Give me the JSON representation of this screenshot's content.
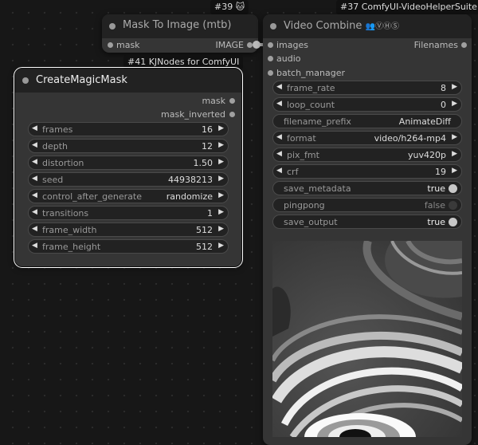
{
  "mask_to_image": {
    "badge": "#39",
    "badge_icon": "fox-icon",
    "title": "Mask To Image (mtb)",
    "input": "mask",
    "output": "IMAGE"
  },
  "magic_mask": {
    "badge": "#41 KJNodes for ComfyUI",
    "title": "CreateMagicMask",
    "outputs": [
      "mask",
      "mask_inverted"
    ],
    "widgets": [
      {
        "label": "frames",
        "value": "16"
      },
      {
        "label": "depth",
        "value": "12"
      },
      {
        "label": "distortion",
        "value": "1.50"
      },
      {
        "label": "seed",
        "value": "44938213"
      },
      {
        "label": "control_after_generate",
        "value": "randomize"
      },
      {
        "label": "transitions",
        "value": "1"
      },
      {
        "label": "frame_width",
        "value": "512"
      },
      {
        "label": "frame_height",
        "value": "512"
      }
    ]
  },
  "video_combine": {
    "badge": "#37 ComfyUI-VideoHelperSuite",
    "title": "Video Combine",
    "title_icons": "👥ⓋⒽⓈ",
    "inputs": [
      "images",
      "audio",
      "batch_manager"
    ],
    "output": "Filenames",
    "widgets": [
      {
        "label": "frame_rate",
        "value": "8"
      },
      {
        "label": "loop_count",
        "value": "0"
      },
      {
        "label": "filename_prefix",
        "value": "AnimateDiff"
      },
      {
        "label": "format",
        "value": "video/h264-mp4"
      },
      {
        "label": "pix_fmt",
        "value": "yuv420p"
      },
      {
        "label": "crf",
        "value": "19"
      },
      {
        "label": "save_metadata",
        "value": "true"
      },
      {
        "label": "pingpong",
        "value": "false"
      },
      {
        "label": "save_output",
        "value": "true"
      }
    ]
  },
  "colors": {
    "canvas": "#171717",
    "node_body": "#353535",
    "node_header": "#222222",
    "selected_outline": "#ffffff",
    "link": "#aaaaaa"
  }
}
